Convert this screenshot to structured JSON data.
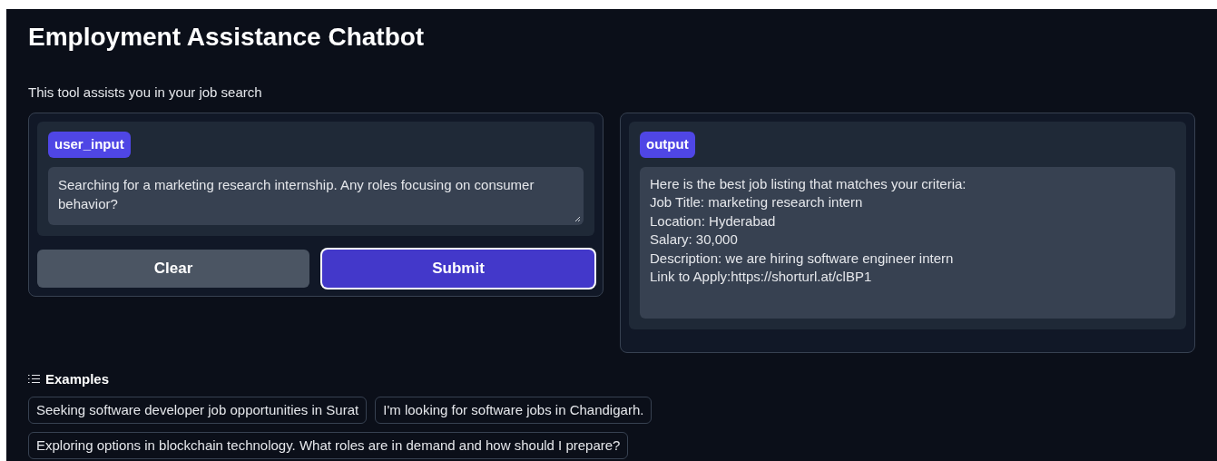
{
  "title": "Employment Assistance Chatbot",
  "description": "This tool assists you in your job search",
  "input": {
    "label": "user_input",
    "value": "Searching for a marketing research internship. Any roles focusing on consumer behavior?"
  },
  "buttons": [
    {
      "label": "Clear",
      "kind": "secondary"
    },
    {
      "label": "Submit",
      "kind": "primary"
    }
  ],
  "output": {
    "label": "output",
    "value": "Here is the best job listing that matches your criteria:\nJob Title: marketing research intern\nLocation: Hyderabad\nSalary: 30,000\nDescription: we are hiring software engineer intern\nLink to Apply:https://shorturl.at/clBP1"
  },
  "examples": {
    "heading": "Examples",
    "items": [
      "Seeking software developer job opportunities in Surat",
      "I'm looking for software jobs in Chandigarh.",
      "Exploring options in blockchain technology. What roles are in demand and how should I prepare?"
    ]
  }
}
